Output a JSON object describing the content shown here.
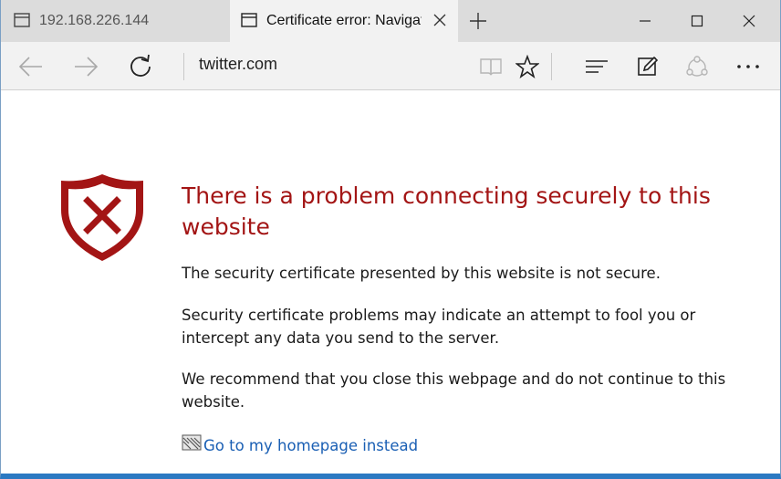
{
  "tabs": [
    {
      "label": "192.168.226.144",
      "active": false
    },
    {
      "label": "Certificate error: Navigation blocked",
      "active": true
    }
  ],
  "address_bar": {
    "url": "twitter.com"
  },
  "error_page": {
    "title": "There is a problem connecting securely to this website",
    "paragraphs": [
      "The security certificate presented by this website is not secure.",
      "Security certificate problems may indicate an attempt to fool you or intercept any data you send to the server.",
      "We recommend that you close this webpage and do not continue to this website."
    ],
    "homepage_link": "Go to my homepage instead"
  },
  "colors": {
    "error_red": "#a31515",
    "link_blue": "#1a5fb4",
    "accent_border": "#2b79c2"
  },
  "icons": {
    "tab": "tab-page-icon",
    "back": "back-arrow-icon",
    "forward": "forward-arrow-icon",
    "refresh": "refresh-icon",
    "reading_view": "reading-view-icon",
    "favorite": "star-icon",
    "hub": "hub-icon",
    "note": "web-note-icon",
    "share": "share-icon",
    "more": "more-icon",
    "shield": "shield-error-icon"
  }
}
